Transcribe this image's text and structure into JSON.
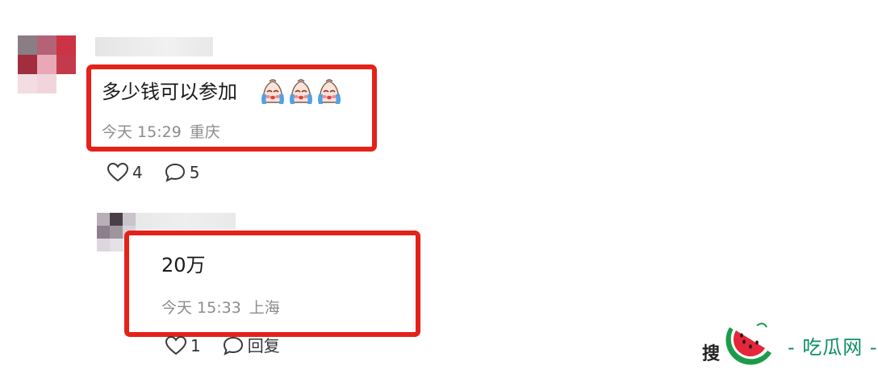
{
  "comments": [
    {
      "text": "多少钱可以参加",
      "emojis": [
        "crying-face",
        "crying-face",
        "crying-face"
      ],
      "time": "今天 15:29",
      "location": "重庆",
      "likes": "4",
      "replies": "5"
    },
    {
      "text": "20万",
      "time": "今天 15:33",
      "location": "上海",
      "likes": "1",
      "reply_label": "回复"
    }
  ],
  "watermark": {
    "partial_char": "搜",
    "brand": "- 吃瓜网 -",
    "brand_color": "#0d8f64"
  },
  "colors": {
    "highlight_red": "#e4221a",
    "meta_gray": "#8c8c8c"
  },
  "icons": {
    "like": "heart-outline-icon",
    "reply": "speech-bubble-icon",
    "emoji": "crying-face-emoji"
  }
}
